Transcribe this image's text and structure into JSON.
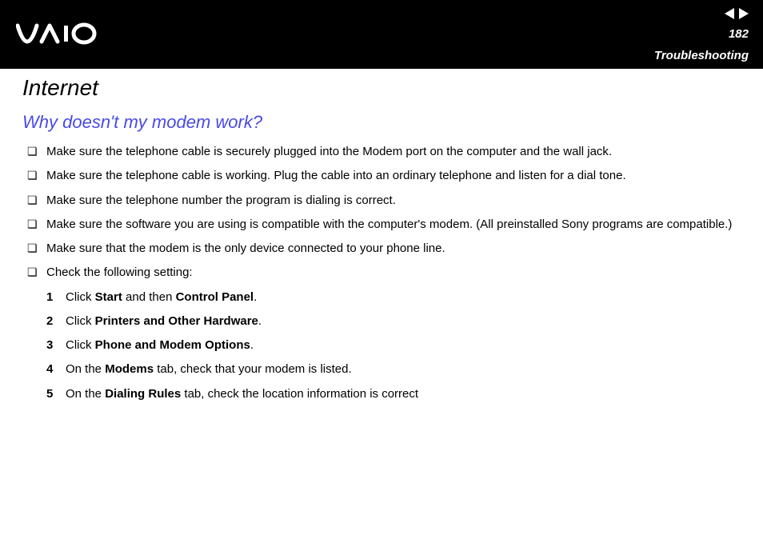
{
  "header": {
    "page_number": "182",
    "section": "Troubleshooting"
  },
  "content": {
    "title": "Internet",
    "subtitle": "Why doesn't my modem work?",
    "bullets": [
      "Make sure the telephone cable is securely plugged into the Modem port on the computer and the wall jack.",
      "Make sure the telephone cable is working. Plug the cable into an ordinary telephone and listen for a dial tone.",
      "Make sure the telephone number the program is dialing is correct.",
      "Make sure the software you are using is compatible with the computer's modem. (All preinstalled Sony programs are compatible.)",
      "Make sure that the modem is the only device connected to your phone line.",
      "Check the following setting:"
    ],
    "steps": [
      {
        "num": "1",
        "parts": [
          "Click ",
          "Start",
          " and then ",
          "Control Panel",
          "."
        ]
      },
      {
        "num": "2",
        "parts": [
          "Click ",
          "Printers and Other Hardware",
          "."
        ]
      },
      {
        "num": "3",
        "parts": [
          "Click ",
          "Phone and Modem Options",
          "."
        ]
      },
      {
        "num": "4",
        "parts": [
          "On the ",
          "Modems",
          " tab, check that your modem is listed."
        ]
      },
      {
        "num": "5",
        "parts": [
          "On the ",
          "Dialing Rules",
          " tab, check the location information is correct"
        ]
      }
    ]
  }
}
